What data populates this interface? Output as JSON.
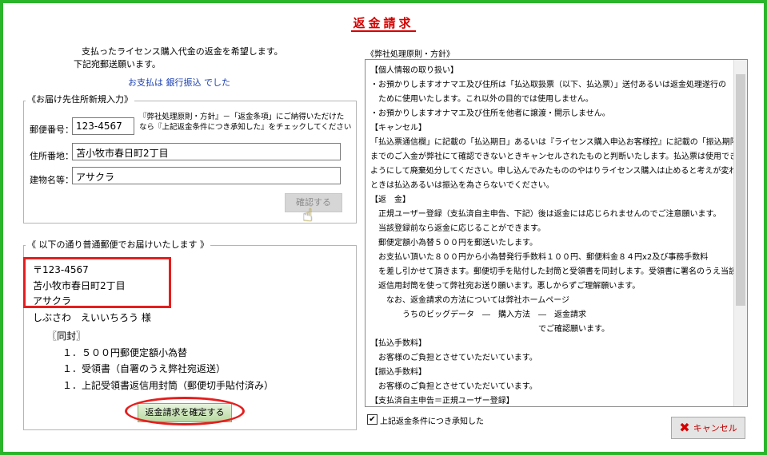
{
  "window": {
    "title": "返金請求"
  },
  "intro": {
    "line1": "支払ったライセンス購入代金の返金を希望します。",
    "line2": "下記宛郵送願います。",
    "payment_prefix": "お支払は",
    "payment_method": "銀行振込",
    "payment_suffix": "でした"
  },
  "address_group": {
    "legend": "《お届け先住所新規入力》",
    "note_line1": "『弊社処理原則・方針』－「返金条項」にご納得いただけた",
    "note_line2": "なら『上記返金条件につき承知した』をチェックしてください",
    "postal_label": "郵便番号：",
    "postal_value": "123-4567",
    "address_label": "住所番地：",
    "address_value": "苫小牧市春日町2丁目",
    "building_label": "建物名等：",
    "building_value": "アサクラ",
    "check_button": "確認する"
  },
  "mail_group": {
    "legend": "《 以下の通り普通郵便でお届けいたします 》",
    "postal": "〒123-4567",
    "address": "苫小牧市春日町2丁目",
    "building": "アサクラ",
    "recipient": "しぶさわ　えいいちろう 様",
    "enclosed_label": "〖同封〗",
    "items": [
      "１．５００円郵便定額小為替",
      "１．受領書（自署のうえ弊社宛返送）",
      "１．上記受領書返信用封筒（郵便切手貼付済み）"
    ],
    "confirm_button": "返金請求を確定する"
  },
  "policy": {
    "heading": "《弊社処理原則・方針》",
    "lines": [
      "【個人情報の取り扱い】",
      "・お預かりしますオナマエ及び住所は「払込取扱票（以下、払込票）」送付あるいは返金処理遂行の",
      "　ために使用いたします。これ以外の目的では使用しません。",
      "・お預かりしますオナマエ及び住所を他者に譲渡・開示しません。",
      "【キャンセル】",
      "「払込票通信欄」に記載の「払込期日」あるいは『ライセンス購入申込お客様控』に記載の「振込期限」",
      "までのご入金が弊社にて確認できないときキャンセルされたものと判断いたします。払込票は使用できない",
      "ようにして廃棄処分してください。申し込んでみたもののやはりライセンス購入は止めると考えが変わった",
      "ときは払込あるいは振込を為さらないでください。",
      "【返　金】",
      "　正規ユーザー登録（支払済自主申告、下記）後は返金には応じられませんのでご注意願います。",
      "　当該登録前なら返金に応じることができます。",
      "　郵便定額小為替５００円を郵送いたします。",
      "　お支払い頂いた８００円から小為替発行手数料１００円、郵便料金８４円x2及び事務手数料",
      "　を差し引かせて頂きます。郵便切手を貼付した封筒と受領書を同封します。受領書に署名のうえ当該",
      "　返信用封筒を使って弊社宛お送り願います。悪しからずご理解願います。",
      "　　なお、返金請求の方法については弊社ホームページ",
      "　　　　うちのビッグデータ　―　購入方法　―　返金請求",
      "　　　　　　　　　　　　　　　　　　　　　でご確認願います。",
      "【払込手数料】",
      "　お客様のご負担とさせていただいています。",
      "【振込手数料】",
      "　お客様のご負担とさせていただいています。",
      "【支払済自主申告＝正規ユーザー登録】"
    ],
    "agree_checkbox": "上記返金条件につき承知した",
    "agree_checked": "✔"
  },
  "cancel_button": "キャンセル",
  "colors": {
    "accent_red": "#d40000",
    "frame_green": "#2bb52b"
  }
}
